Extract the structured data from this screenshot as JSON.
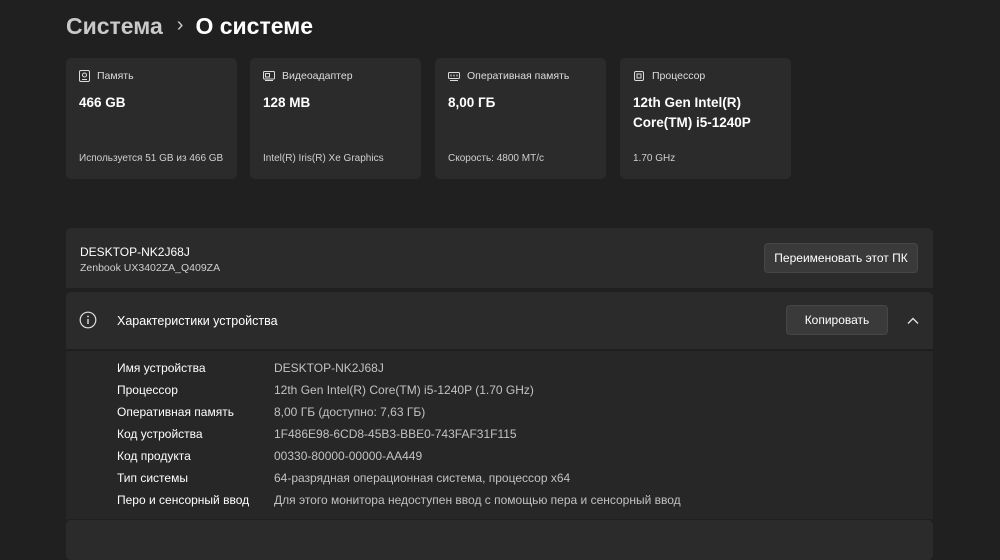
{
  "breadcrumb": {
    "parent": "Система",
    "separator": "›",
    "current": "О системе"
  },
  "cards": [
    {
      "label": "Память",
      "value": "466 GB",
      "footer": "Используется 51 GB из 466 GB",
      "icon": "storage-icon"
    },
    {
      "label": "Видеоадаптер",
      "value": "128 MB",
      "footer": "Intel(R) Iris(R) Xe Graphics",
      "icon": "gpu-icon"
    },
    {
      "label": "Оперативная память",
      "value": "8,00 ГБ",
      "footer": "Скорость: 4800 MT/c",
      "icon": "ram-icon"
    },
    {
      "label": "Процессор",
      "value_line1": "12th Gen Intel(R)",
      "value_line2": "Core(TM) i5-1240P",
      "footer": "1.70 GHz",
      "icon": "cpu-icon"
    }
  ],
  "device": {
    "name": "DESKTOP-NK2J68J",
    "model": "Zenbook UX3402ZA_Q409ZA",
    "rename_label": "Переименовать этот ПК"
  },
  "specs": {
    "title": "Характеристики устройства",
    "copy_label": "Копировать",
    "rows": [
      {
        "label": "Имя устройства",
        "value": "DESKTOP-NK2J68J"
      },
      {
        "label": "Процессор",
        "value": "12th Gen Intel(R) Core(TM) i5-1240P (1.70 GHz)"
      },
      {
        "label": "Оперативная память",
        "value": "8,00 ГБ (доступно: 7,63 ГБ)"
      },
      {
        "label": "Код устройства",
        "value": "1F486E98-6CD8-45B3-BBE0-743FAF31F115"
      },
      {
        "label": "Код продукта",
        "value": "00330-80000-00000-AA449"
      },
      {
        "label": "Тип системы",
        "value": "64-разрядная операционная система, процессор x64"
      },
      {
        "label": "Перо и сенсорный ввод",
        "value": "Для этого монитора недоступен ввод с помощью пера и сенсорный ввод"
      }
    ]
  },
  "colors": {
    "background": "#202020",
    "card": "#2b2b2b",
    "muted_text": "#c2c2c2"
  }
}
